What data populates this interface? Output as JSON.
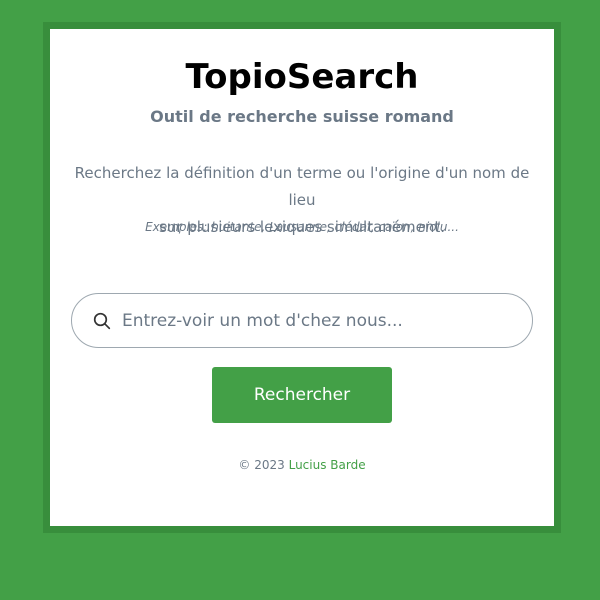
{
  "header": {
    "title": "TopioSearch",
    "subtitle": "Outil de recherche suisse romand"
  },
  "intro": {
    "line1": "Recherchez la définition d'un terme ou l'origine d'un nom de lieu",
    "line2": "sur plusieurs lexiques simultanément.",
    "examples": "Exemples: huitante, Lausanne, clédar, caïon, niolu..."
  },
  "search": {
    "placeholder": "Entrez-voir un mot d'chez nous...",
    "value": "",
    "icon": "search-icon",
    "button_label": "Rechercher"
  },
  "footer": {
    "copyright": "© 2023",
    "author_link": "Lucius Barde"
  },
  "colors": {
    "background": "#43a047",
    "frame": "#388e3c",
    "accent": "#43a047",
    "muted_text": "#6b7886"
  }
}
